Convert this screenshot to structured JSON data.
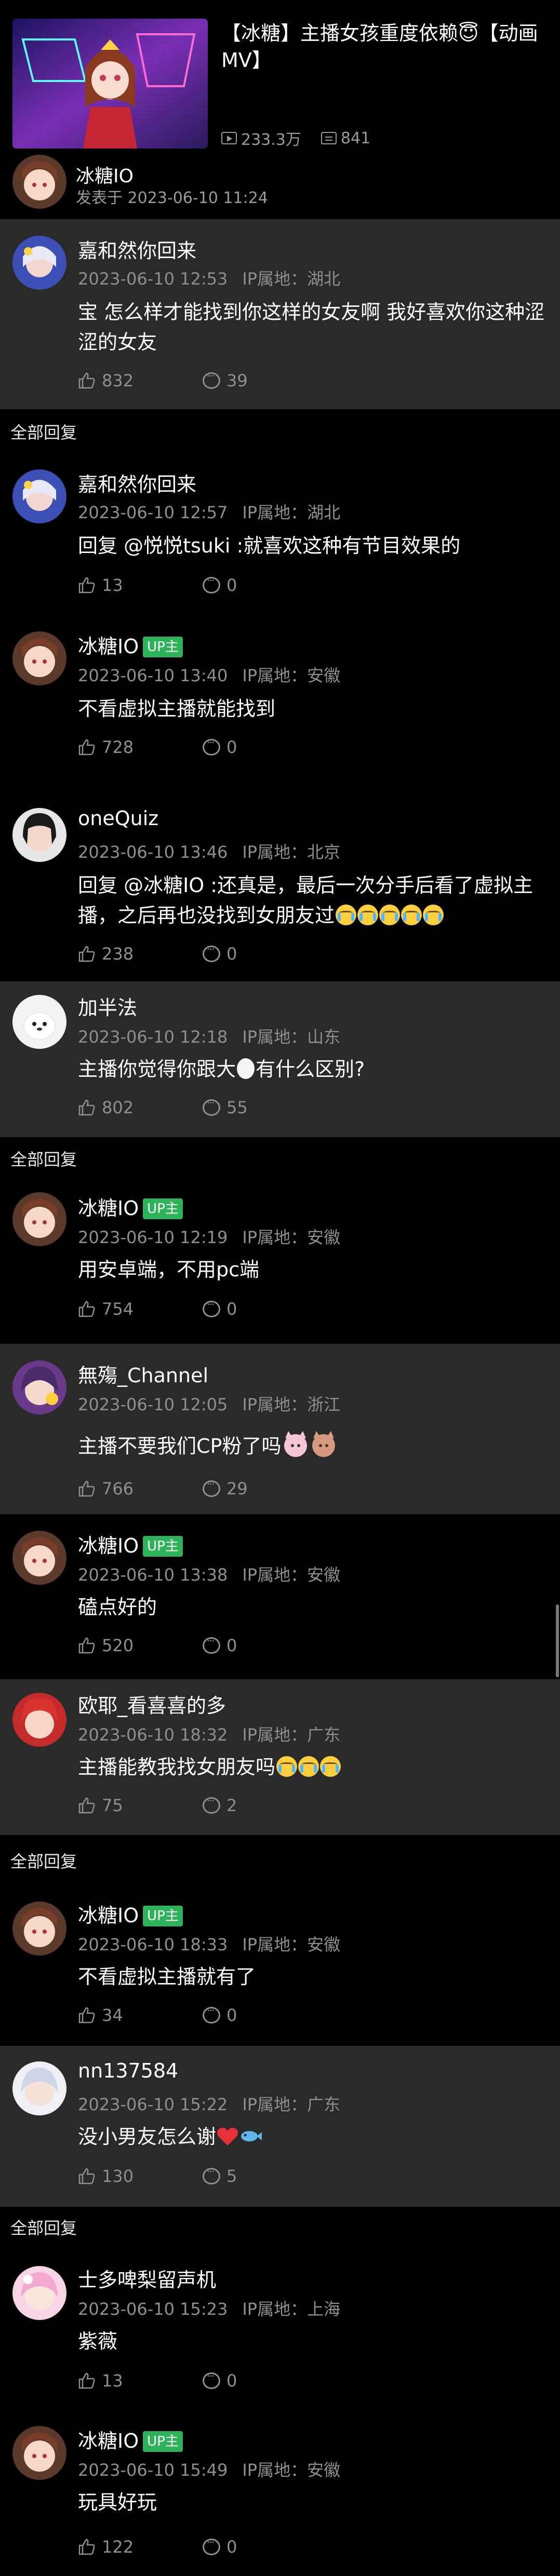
{
  "video": {
    "title": "【冰糖】主播女孩重度依赖😇【动画MV】",
    "plays": "233.3万",
    "danmaku": "841"
  },
  "poster": {
    "name": "冰糖IO",
    "time": "发表于 2023-06-10 11:24"
  },
  "section_all_replies": "全部回复",
  "up_badge": "UP主",
  "comments": [
    {
      "name": "嘉和然你回来",
      "date": "2023-06-10 12:53",
      "ip": "IP属地：湖北",
      "text": "宝 怎么样才能找到你这样的女友啊 我好喜欢你这种涩涩的女友",
      "likes": "832",
      "replies": "39"
    },
    {
      "name": "嘉和然你回来",
      "date": "2023-06-10 12:57",
      "ip": "IP属地：湖北",
      "text": "回复 @悦悦tsuki :就喜欢这种有节目效果的",
      "likes": "13",
      "replies": "0"
    },
    {
      "name": "冰糖IO",
      "date": "2023-06-10 13:40",
      "ip": "IP属地：安徽",
      "text": "不看虚拟主播就能找到",
      "likes": "728",
      "replies": "0"
    },
    {
      "name": "oneQuiz",
      "date": "2023-06-10 13:46",
      "ip": "IP属地：北京",
      "text": "回复 @冰糖IO :还真是，最后一次分手后看了虚拟主播，之后再也没找到女朋友过",
      "likes": "238",
      "replies": "0"
    },
    {
      "name": "加半法",
      "date": "2023-06-10 12:18",
      "ip": "IP属地：山东",
      "text": "主播你觉得你跟大",
      "text2": "有什么区别?",
      "likes": "802",
      "replies": "55"
    },
    {
      "name": "冰糖IO",
      "date": "2023-06-10 12:19",
      "ip": "IP属地：安徽",
      "text": "用安卓端，不用pc端",
      "likes": "754",
      "replies": "0"
    },
    {
      "name": "無殤_Channel",
      "date": "2023-06-10 12:05",
      "ip": "IP属地：浙江",
      "text": "主播不要我们CP粉了吗",
      "likes": "766",
      "replies": "29"
    },
    {
      "name": "冰糖IO",
      "date": "2023-06-10 13:38",
      "ip": "IP属地：安徽",
      "text": "磕点好的",
      "likes": "520",
      "replies": "0"
    },
    {
      "name": "欧耶_看喜喜的多",
      "date": "2023-06-10 18:32",
      "ip": "IP属地：广东",
      "text": "主播能教我找女朋友吗",
      "likes": "75",
      "replies": "2"
    },
    {
      "name": "冰糖IO",
      "date": "2023-06-10 18:33",
      "ip": "IP属地：安徽",
      "text": "不看虚拟主播就有了",
      "likes": "34",
      "replies": "0"
    },
    {
      "name": "nn137584",
      "date": "2023-06-10 15:22",
      "ip": "IP属地：广东",
      "text": "没小男友怎么谢",
      "likes": "130",
      "replies": "5"
    },
    {
      "name": "士多啤梨留声机",
      "date": "2023-06-10 15:23",
      "ip": "IP属地：上海",
      "text": "紫薇",
      "likes": "13",
      "replies": "0"
    },
    {
      "name": "冰糖IO",
      "date": "2023-06-10 15:49",
      "ip": "IP属地：安徽",
      "text": "玩具好玩",
      "likes": "122",
      "replies": "0"
    }
  ],
  "colors": {
    "background": "#000000",
    "comment_highlight": "#2a2a2a",
    "meta_text": "#8f8f8f",
    "up_badge": "#2fb35a"
  },
  "icons": [
    "play-count-icon",
    "danmaku-icon",
    "thumbs-up-icon",
    "reply-bubble-icon",
    "cry-emoji",
    "heart-emoji",
    "fish-emoji",
    "egg-emoji"
  ]
}
